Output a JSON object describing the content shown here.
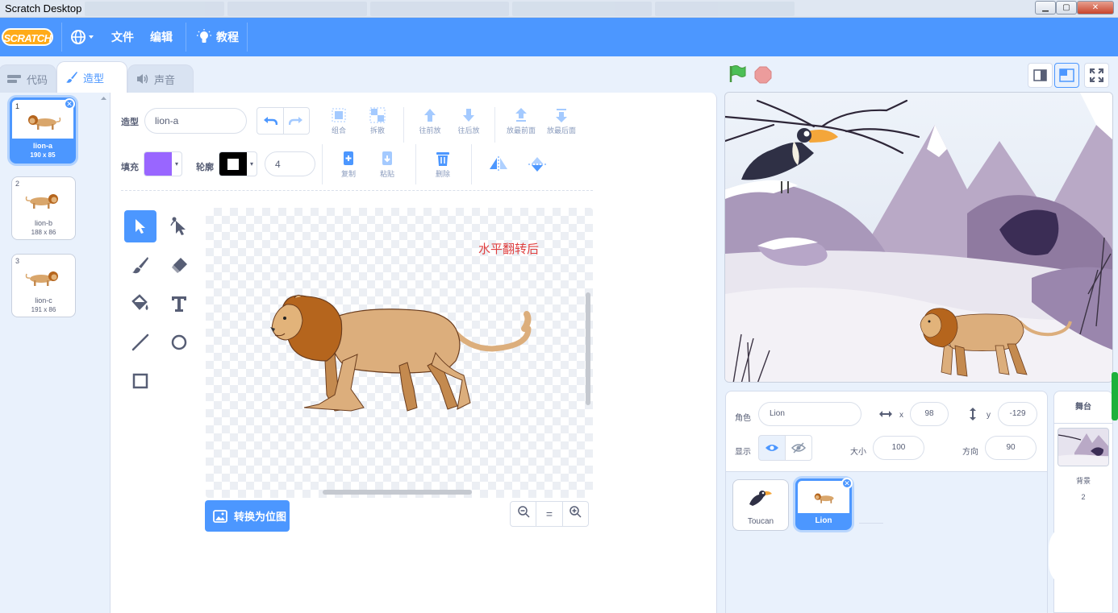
{
  "window": {
    "title": "Scratch Desktop",
    "minimize": "▁",
    "maximize": "▢",
    "close": "✕"
  },
  "menubar": {
    "logo": "SCRATCH",
    "file": "文件",
    "edit": "编辑",
    "tutorials": "教程"
  },
  "tabs": {
    "code": "代码",
    "costumes": "造型",
    "sounds": "声音"
  },
  "costumes": [
    {
      "num": "1",
      "name": "lion-a",
      "size": "190 x 85",
      "selected": true
    },
    {
      "num": "2",
      "name": "lion-b",
      "size": "188 x 86",
      "selected": false
    },
    {
      "num": "3",
      "name": "lion-c",
      "size": "191 x 86",
      "selected": false
    }
  ],
  "paint": {
    "costume_label": "造型",
    "costume_name": "lion-a",
    "fill_label": "填充",
    "outline_label": "轮廓",
    "outline_width": "4",
    "fill_color": "#9966ff",
    "outline_color": "#000000",
    "buttons": {
      "group": "组合",
      "ungroup": "拆散",
      "forward": "往前放",
      "backward": "往后放",
      "front": "放最前面",
      "back": "放最后面",
      "copy": "复制",
      "paste": "粘贴",
      "delete": "删除"
    },
    "annotation": "水平翻转后",
    "convert_label": "转换为位图",
    "zoom": {
      "out": "−",
      "reset": "=",
      "in": "+"
    }
  },
  "sprite_info": {
    "sprite_label": "角色",
    "sprite_name": "Lion",
    "x_label": "x",
    "x": "98",
    "y_label": "y",
    "y": "-129",
    "show_label": "显示",
    "size_label": "大小",
    "size": "100",
    "direction_label": "方向",
    "direction": "90"
  },
  "sprites": [
    {
      "name": "Toucan",
      "selected": false
    },
    {
      "name": "Lion",
      "selected": true
    }
  ],
  "stage_target": {
    "header": "舞台",
    "backdrop_label": "背景",
    "backdrop_count": "2"
  },
  "colors": {
    "accent": "#4c97ff",
    "flag": "#4cbf56",
    "stop": "#ec9c9c"
  }
}
